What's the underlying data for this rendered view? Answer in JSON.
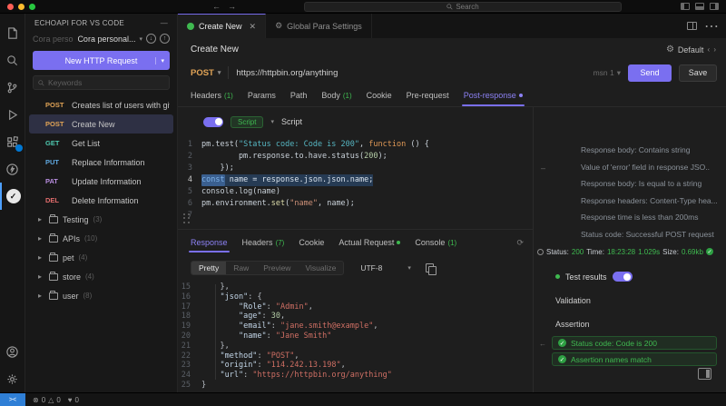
{
  "colors": {
    "accent_purple": "#7a6ff0",
    "success_green": "#3fb950",
    "method_post": "#e0a356",
    "method_get": "#4ec9b0",
    "method_put": "#5fa8e0",
    "method_patch": "#b98ee0",
    "method_delete": "#e06c6c",
    "remote_blue": "#2f7fd6"
  },
  "titlebar": {
    "search_placeholder": "Search",
    "back_arrow": "←",
    "forward_arrow": "→"
  },
  "sidebar": {
    "title": "ECHOAPI FOR VS CODE",
    "more_label": "—",
    "workspace_dim": "Cora personal",
    "workspace_selector": "Cora personal...",
    "new_request_button": "New HTTP Request",
    "search_placeholder": "Keywords",
    "requests": [
      {
        "method": "POST",
        "label": "Creates list of users with given i...",
        "selected": false
      },
      {
        "method": "POST",
        "label": "Create New",
        "selected": true
      },
      {
        "method": "GET",
        "label": "Get List",
        "selected": false
      },
      {
        "method": "PUT",
        "label": "Replace Information",
        "selected": false
      },
      {
        "method": "PAT",
        "label": "Update Information",
        "selected": false
      },
      {
        "method": "DEL",
        "label": "Delete Information",
        "selected": false
      }
    ],
    "folders": [
      {
        "name": "Testing",
        "count": "(3)"
      },
      {
        "name": "APIs",
        "count": "(10)"
      },
      {
        "name": "pet",
        "count": "(4)"
      },
      {
        "name": "store",
        "count": "(4)"
      },
      {
        "name": "user",
        "count": "(8)"
      }
    ]
  },
  "editor_tabs": [
    {
      "label": "Create New",
      "active": true,
      "closable": true
    },
    {
      "label": "Global Para Settings",
      "active": false,
      "closable": false
    }
  ],
  "panel": {
    "title": "Create New",
    "environment": "Default"
  },
  "request": {
    "method": "POST",
    "url": "https://httpbin.org/anything",
    "service_label": "msn 1",
    "send_label": "Send",
    "save_label": "Save",
    "tabs": [
      {
        "label": "Headers",
        "count": "(1)"
      },
      {
        "label": "Params"
      },
      {
        "label": "Path"
      },
      {
        "label": "Body",
        "count": "(1)"
      },
      {
        "label": "Cookie"
      },
      {
        "label": "Pre-request"
      },
      {
        "label": "Post-response",
        "active": true,
        "dot": true
      }
    ]
  },
  "script": {
    "badge": "Script",
    "type_label": "Script",
    "lines": [
      {
        "n": "1",
        "seg": [
          [
            "pm.test(",
            "pl"
          ],
          [
            "\"Status code: Code is 200\"",
            "strb"
          ],
          [
            ", ",
            "pl"
          ],
          [
            "function",
            "kw"
          ],
          [
            " () {",
            "pl"
          ]
        ]
      },
      {
        "n": "2",
        "seg": [
          [
            "        pm.response.to.have.status(",
            "pl"
          ],
          [
            "200",
            "num"
          ],
          [
            ");",
            "pl"
          ]
        ]
      },
      {
        "n": "3",
        "seg": [
          [
            "    });",
            "pl"
          ]
        ]
      },
      {
        "n": "4",
        "cursor": true,
        "seg": [
          [
            "const",
            "kwsel"
          ],
          [
            " name = response.json.json.name;",
            "plsel"
          ]
        ]
      },
      {
        "n": "5",
        "seg": [
          [
            "console.log(name)",
            "pl"
          ]
        ]
      },
      {
        "n": "6",
        "seg": [
          [
            "pm.environment.",
            "pl"
          ],
          [
            "set",
            "fn"
          ],
          [
            "(",
            "pl"
          ],
          [
            "\"name\"",
            "strr"
          ],
          [
            ", name);",
            "pl"
          ]
        ]
      },
      {
        "n": "7",
        "seg": []
      }
    ]
  },
  "response": {
    "tabs": [
      {
        "label": "Response",
        "active": true
      },
      {
        "label": "Headers",
        "count": "(7)"
      },
      {
        "label": "Cookie"
      },
      {
        "label": "Actual Request",
        "gdot": true
      },
      {
        "label": "Console",
        "count": "(1)"
      }
    ],
    "modes": [
      {
        "label": "Pretty",
        "active": true
      },
      {
        "label": "Raw"
      },
      {
        "label": "Preview"
      },
      {
        "label": "Visualize"
      }
    ],
    "encoding": "UTF-8",
    "json_lines": [
      {
        "n": "15",
        "seg": [
          [
            "    },",
            "jp"
          ]
        ]
      },
      {
        "n": "16",
        "seg": [
          [
            "    ",
            "jp"
          ],
          [
            "\"json\"",
            "jk"
          ],
          [
            ": {",
            "jp"
          ]
        ]
      },
      {
        "n": "17",
        "seg": [
          [
            "        ",
            "jp"
          ],
          [
            "\"Role\"",
            "jk"
          ],
          [
            ": ",
            "jp"
          ],
          [
            "\"Admin\"",
            "jv"
          ],
          [
            ",",
            "jp"
          ]
        ]
      },
      {
        "n": "18",
        "seg": [
          [
            "        ",
            "jp"
          ],
          [
            "\"age\"",
            "jk"
          ],
          [
            ": ",
            "jp"
          ],
          [
            "30",
            "jn"
          ],
          [
            ",",
            "jp"
          ]
        ]
      },
      {
        "n": "19",
        "seg": [
          [
            "        ",
            "jp"
          ],
          [
            "\"email\"",
            "jk"
          ],
          [
            ": ",
            "jp"
          ],
          [
            "\"jane.smith@example\"",
            "jv"
          ],
          [
            ",",
            "jp"
          ]
        ]
      },
      {
        "n": "20",
        "seg": [
          [
            "        ",
            "jp"
          ],
          [
            "\"name\"",
            "jk"
          ],
          [
            ": ",
            "jp"
          ],
          [
            "\"Jane Smith\"",
            "jv"
          ]
        ]
      },
      {
        "n": "21",
        "seg": [
          [
            "    },",
            "jp"
          ]
        ]
      },
      {
        "n": "22",
        "seg": [
          [
            "    ",
            "jp"
          ],
          [
            "\"method\"",
            "jk"
          ],
          [
            ": ",
            "jp"
          ],
          [
            "\"POST\"",
            "jv"
          ],
          [
            ",",
            "jp"
          ]
        ]
      },
      {
        "n": "23",
        "seg": [
          [
            "    ",
            "jp"
          ],
          [
            "\"origin\"",
            "jk"
          ],
          [
            ": ",
            "jp"
          ],
          [
            "\"114.242.13.198\"",
            "jv"
          ],
          [
            ",",
            "jp"
          ]
        ]
      },
      {
        "n": "24",
        "seg": [
          [
            "    ",
            "jp"
          ],
          [
            "\"url\"",
            "jk"
          ],
          [
            ": ",
            "jp"
          ],
          [
            "\"https://httpbin.org/anything\"",
            "jv"
          ]
        ]
      },
      {
        "n": "25",
        "seg": [
          [
            "}",
            "jp"
          ]
        ]
      }
    ]
  },
  "right_panel": {
    "snippets": [
      "Response body: Contains string",
      "Value of 'error' field in response JSO..",
      "Response body: Is equal to a string",
      "Response headers: Content-Type hea...",
      "Response time is less than 200ms",
      "Status code: Successful POST request"
    ],
    "status": {
      "status_label": "Status:",
      "status_value": "200",
      "time_label": "Time:",
      "time_value": "18:23:28",
      "duration": "1.029s",
      "size_label": "Size:",
      "size_value": "0.69kb"
    },
    "test_results_label": "Test results",
    "validation_label": "Validation",
    "assertion_label": "Assertion",
    "assertions": [
      "Status code: Code is 200",
      "Assertion names match"
    ]
  },
  "status_bar": {
    "errors": "0",
    "warnings": "0",
    "bell_count": "0",
    "feedback_count": "0"
  }
}
